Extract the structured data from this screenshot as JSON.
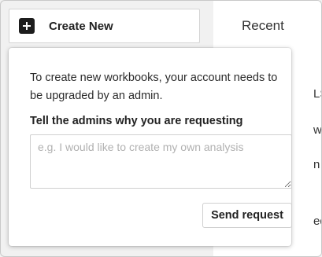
{
  "toolbar": {
    "create_label": "Create New",
    "create_icon": "plus-square-icon"
  },
  "background": {
    "recent_label": "Recent",
    "peek_fragments": [
      "LS",
      "w",
      "n",
      "ed"
    ]
  },
  "popover": {
    "message": "To create new workbooks, your account needs to be upgraded by an admin.",
    "field_label": "Tell the admins why you are requesting",
    "reason_placeholder": "e.g. I would like to create my own analysis",
    "reason_value": "",
    "send_label": "Send request"
  }
}
